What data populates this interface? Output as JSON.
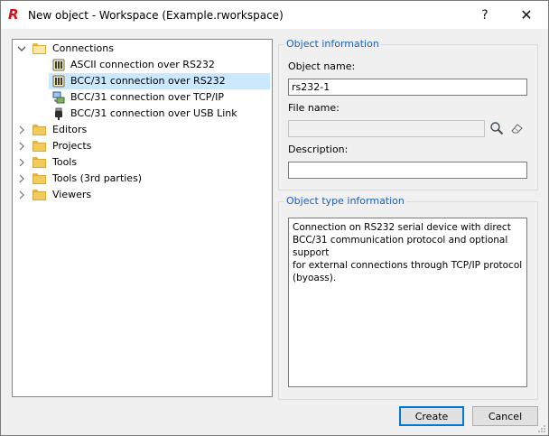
{
  "window": {
    "title": "New object - Workspace (Example.rworkspace)",
    "logo_letter": "R",
    "help_label": "?",
    "close_label": "✕"
  },
  "tree": {
    "items": [
      {
        "label": "Connections",
        "expanded": true,
        "icon": "folder-open-icon"
      },
      {
        "label": "ASCII connection over RS232",
        "icon": "serial-connection-icon"
      },
      {
        "label": "BCC/31 connection over RS232",
        "icon": "serial-connection-icon",
        "selected": true
      },
      {
        "label": "BCC/31 connection over TCP/IP",
        "icon": "network-connection-icon"
      },
      {
        "label": "BCC/31 connection over USB Link",
        "icon": "usb-connection-icon"
      },
      {
        "label": "Editors",
        "expanded": false,
        "icon": "folder-icon"
      },
      {
        "label": "Projects",
        "expanded": false,
        "icon": "folder-icon"
      },
      {
        "label": "Tools",
        "expanded": false,
        "icon": "folder-icon"
      },
      {
        "label": "Tools (3rd parties)",
        "expanded": false,
        "icon": "folder-icon"
      },
      {
        "label": "Viewers",
        "expanded": false,
        "icon": "folder-icon"
      }
    ]
  },
  "object_info": {
    "legend": "Object information",
    "name_label": "Object name:",
    "name_value": "rs232-1",
    "file_label": "File name:",
    "file_value": "",
    "description_label": "Description:",
    "description_value": ""
  },
  "type_info": {
    "legend": "Object type information",
    "text": "Connection on RS232 serial device with direct\nBCC/31 communication protocol and optional support\nfor external connections through TCP/IP protocol\n(byoass)."
  },
  "buttons": {
    "create": "Create",
    "cancel": "Cancel"
  },
  "colors": {
    "accent": "#0078d7",
    "selection": "#cce8ff",
    "legend_text": "#1f5fb4",
    "logo": "#d4141b"
  }
}
